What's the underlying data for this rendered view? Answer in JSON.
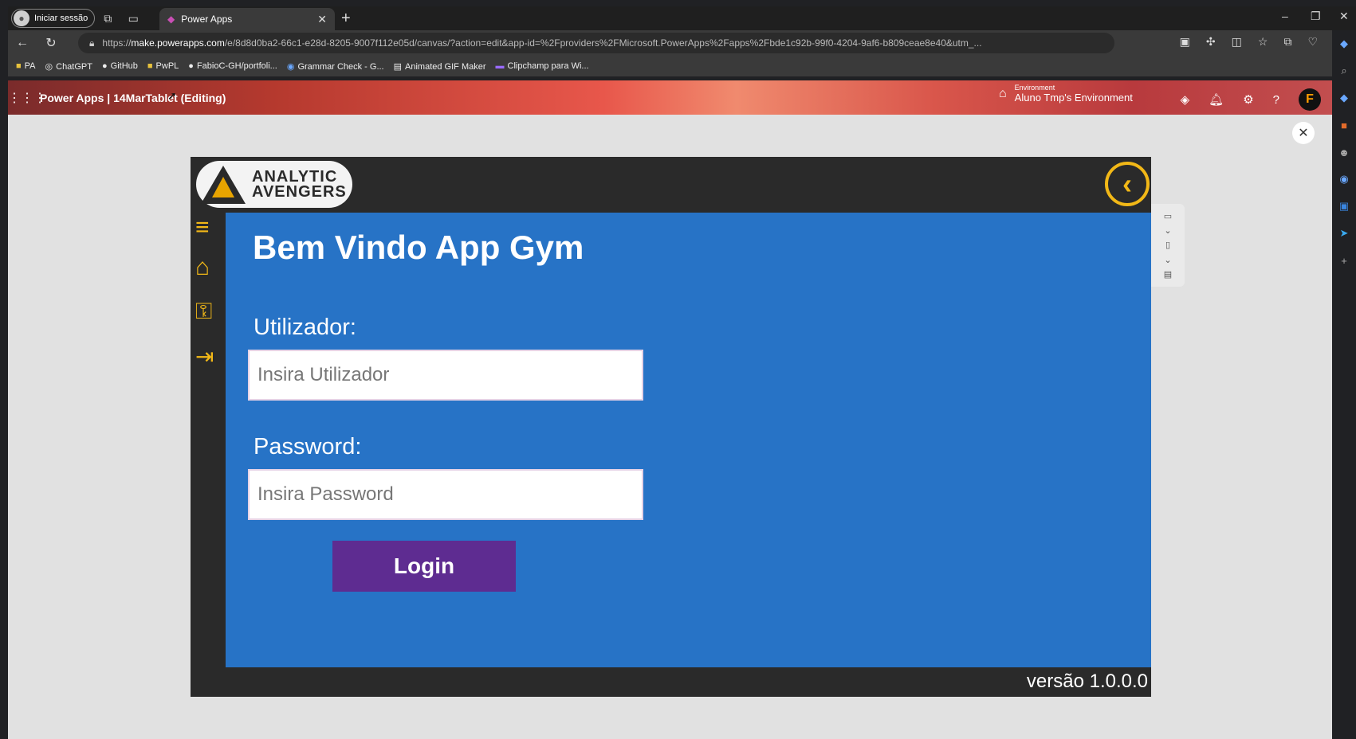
{
  "browser": {
    "profile_label": "Iniciar sessão",
    "tab_title": "Power Apps",
    "url_prefix": "https://",
    "url_host": "make.powerapps.com",
    "url_path": "/e/8d8d0ba2-66c1-e28d-8205-9007f112e05d/canvas/?action=edit&app-id=%2Fproviders%2FMicrosoft.PowerApps%2Fapps%2Fbde1c92b-99f0-4204-9af6-b809ceae8e40&utm_...",
    "bookmarks": [
      "PA",
      "ChatGPT",
      "GitHub",
      "PwPL",
      "FabioC-GH/portfoli...",
      "Grammar Check - G...",
      "Animated GIF Maker",
      "Clipchamp para Wi..."
    ]
  },
  "powerapps": {
    "title": "Power Apps  |  14MarTablet (Editing)",
    "env_label": "Environment",
    "env_name": "Aluno Tmp's Environment",
    "avatar_letter": "F"
  },
  "app": {
    "logo_line1": "ANALYTIC",
    "logo_line2": "AVENGERS",
    "welcome": "Bem Vindo App Gym",
    "user_label": "Utilizador:",
    "user_placeholder": "Insira Utilizador",
    "pass_label": "Password:",
    "pass_placeholder": "Insira Password",
    "login_label": "Login",
    "version": "versão 1.0.0.0"
  },
  "colors": {
    "panel_blue": "#2773c6",
    "accent_yellow": "#f2b817",
    "login_purple": "#5e2c91",
    "dark": "#2a2a2a"
  },
  "icons": [
    "menu-icon",
    "home-icon",
    "key-icon",
    "logout-icon",
    "back-icon",
    "close-icon",
    "settings-icon",
    "notification-icon",
    "help-icon"
  ]
}
